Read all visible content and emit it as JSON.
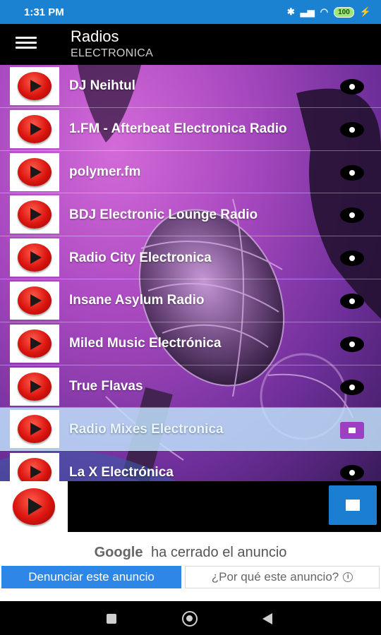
{
  "status_bar": {
    "time": "1:31 PM",
    "battery": "100",
    "icons": [
      "bluetooth-icon",
      "signal-icon",
      "wifi-icon",
      "battery-icon",
      "charging-icon"
    ]
  },
  "app_bar": {
    "title": "Radios",
    "subtitle": "ELECTRONICA"
  },
  "stations": [
    {
      "name": "DJ Neihtul",
      "state": "idle"
    },
    {
      "name": "1.FM - Afterbeat Electronica Radio",
      "state": "idle"
    },
    {
      "name": "polymer.fm",
      "state": "idle"
    },
    {
      "name": "BDJ Electronic Lounge Radio",
      "state": "idle"
    },
    {
      "name": "Radio City Electronica",
      "state": "idle"
    },
    {
      "name": "Insane Asylum Radio",
      "state": "idle"
    },
    {
      "name": "Miled Music Electrónica",
      "state": "idle"
    },
    {
      "name": "True Flavas",
      "state": "idle"
    },
    {
      "name": "Radio Mixes Electronica",
      "state": "playing"
    },
    {
      "name": "La X Electrónica",
      "state": "idle"
    }
  ],
  "ad": {
    "brand": "Google",
    "closed_text": "ha cerrado el anuncio",
    "report_button": "Denunciar este anuncio",
    "why_button": "¿Por qué este anuncio?"
  },
  "colors": {
    "status_bar": "#1b82d1",
    "selected_row": "#bee1fa",
    "stop_button": "#1c7ed0",
    "report_button": "#2e87e6"
  }
}
